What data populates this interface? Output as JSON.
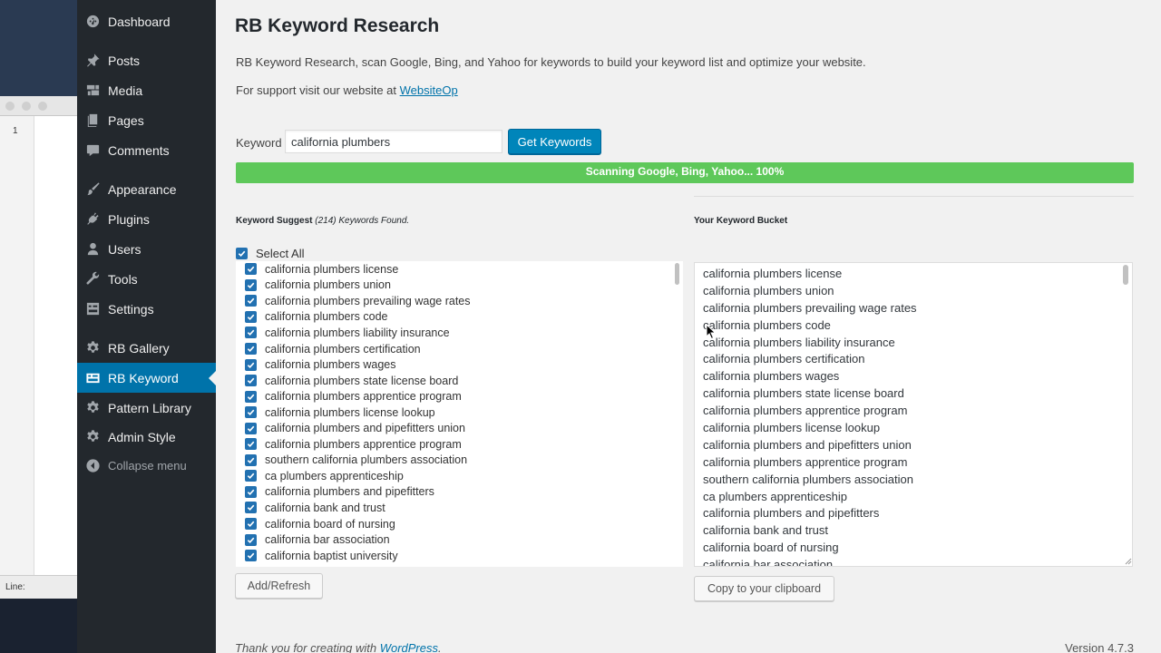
{
  "background_window": {
    "line_number": "1",
    "status_label": "Line:"
  },
  "admin_menu": {
    "items": [
      {
        "label": "Dashboard",
        "icon": "dashboard-icon"
      },
      {
        "label": "Posts",
        "icon": "pin-icon"
      },
      {
        "label": "Media",
        "icon": "media-icon"
      },
      {
        "label": "Pages",
        "icon": "pages-icon"
      },
      {
        "label": "Comments",
        "icon": "comment-icon"
      },
      {
        "label": "Appearance",
        "icon": "brush-icon"
      },
      {
        "label": "Plugins",
        "icon": "plug-icon"
      },
      {
        "label": "Users",
        "icon": "user-icon"
      },
      {
        "label": "Tools",
        "icon": "wrench-icon"
      },
      {
        "label": "Settings",
        "icon": "settings-icon"
      },
      {
        "label": "RB Gallery",
        "icon": "gear-icon"
      },
      {
        "label": "RB Keyword",
        "icon": "keyword-icon",
        "active": true
      },
      {
        "label": "Pattern Library",
        "icon": "gear-icon"
      },
      {
        "label": "Admin Style",
        "icon": "gear-icon"
      }
    ],
    "collapse_label": "Collapse menu"
  },
  "page": {
    "title": "RB Keyword Research",
    "description": "RB Keyword Research, scan Google, Bing, and Yahoo for keywords to build your keyword list and optimize your website.",
    "support_text": "For support visit our website at ",
    "support_link": "WebsiteOp"
  },
  "search": {
    "label": "Keyword",
    "value": "california plumbers",
    "button": "Get Keywords"
  },
  "progress": {
    "text": "Scanning Google, Bing, Yahoo... 100%",
    "percent": 100,
    "color": "#5ec85a"
  },
  "suggest": {
    "heading": "Keyword Suggest ",
    "count_text": "(214) Keywords Found.",
    "select_all": "Select All",
    "items": [
      "california plumbers license",
      "california plumbers union",
      "california plumbers prevailing wage rates",
      "california plumbers code",
      "california plumbers liability insurance",
      "california plumbers certification",
      "california plumbers wages",
      "california plumbers state license board",
      "california plumbers apprentice program",
      "california plumbers license lookup",
      "california plumbers and pipefitters union",
      "california plumbers apprentice program",
      "southern california plumbers association",
      "ca plumbers apprenticeship",
      "california plumbers and pipefitters",
      "california bank and trust",
      "california board of nursing",
      "california bar association",
      "california baptist university"
    ],
    "add_button": "Add/Refresh"
  },
  "bucket": {
    "heading": "Your Keyword Bucket",
    "items": [
      "california plumbers license",
      "california plumbers union",
      "california plumbers prevailing wage rates",
      "california plumbers code",
      "california plumbers liability insurance",
      "california plumbers certification",
      "california plumbers wages",
      "california plumbers state license board",
      "california plumbers apprentice program",
      "california plumbers license lookup",
      "california plumbers and pipefitters union",
      "california plumbers apprentice program",
      "southern california plumbers association",
      "ca plumbers apprenticeship",
      "california plumbers and pipefitters",
      "california bank and trust",
      "california board of nursing",
      "california bar association"
    ],
    "copy_button": "Copy to your clipboard"
  },
  "footer": {
    "text": "Thank you for creating with ",
    "link": "WordPress",
    "end": ".",
    "version": "Version 4.7.3"
  },
  "colors": {
    "accent": "#0073aa",
    "menu_bg": "#23282d",
    "button_primary": "#0085ba"
  }
}
